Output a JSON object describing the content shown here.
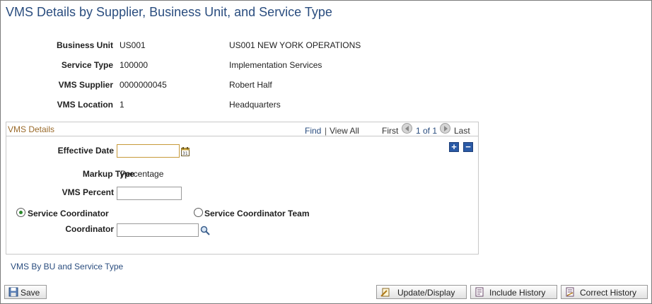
{
  "page": {
    "title": "VMS Details by Supplier, Business Unit, and Service Type"
  },
  "header_fields": {
    "business_unit": {
      "label": "Business Unit",
      "code": "US001",
      "description": "US001 NEW YORK OPERATIONS"
    },
    "service_type": {
      "label": "Service Type",
      "code": "100000",
      "description": "Implementation Services"
    },
    "vms_supplier": {
      "label": "VMS Supplier",
      "code": "0000000045",
      "description": "Robert Half"
    },
    "vms_location": {
      "label": "VMS Location",
      "code": "1",
      "description": "Headquarters"
    }
  },
  "grid": {
    "title": "VMS Details",
    "find": "Find",
    "separator": "|",
    "view_all": "View All",
    "first": "First",
    "count": "1 of 1",
    "last": "Last",
    "add_symbol": "+",
    "remove_symbol": "−",
    "effective_date": {
      "label": "Effective Date",
      "value": ""
    },
    "markup_type": {
      "label": "Markup Type",
      "value": "Percentage"
    },
    "vms_percent": {
      "label": "VMS Percent",
      "value": ""
    },
    "radio_service_coordinator": {
      "label": "Service Coordinator",
      "selected": true
    },
    "radio_service_coordinator_team": {
      "label": "Service Coordinator Team",
      "selected": false
    },
    "coordinator": {
      "label": "Coordinator",
      "value": ""
    }
  },
  "links": {
    "vms_by_bu": "VMS By BU and Service Type"
  },
  "toolbar": {
    "save": "Save",
    "update_display": "Update/Display",
    "include_history": "Include History",
    "correct_history": "Correct History"
  },
  "colors": {
    "title": "#2a4d7f",
    "grid_title": "#9a6a2a",
    "link": "#2a4d7f",
    "accent_button": "#2a5aa6",
    "radio_selected": "#2c8a2c"
  },
  "icons": {
    "calendar": "calendar-icon",
    "lookup": "magnifier-icon",
    "save": "save-icon",
    "update": "update-icon",
    "include_history": "history-icon",
    "correct_history": "correct-history-icon"
  }
}
